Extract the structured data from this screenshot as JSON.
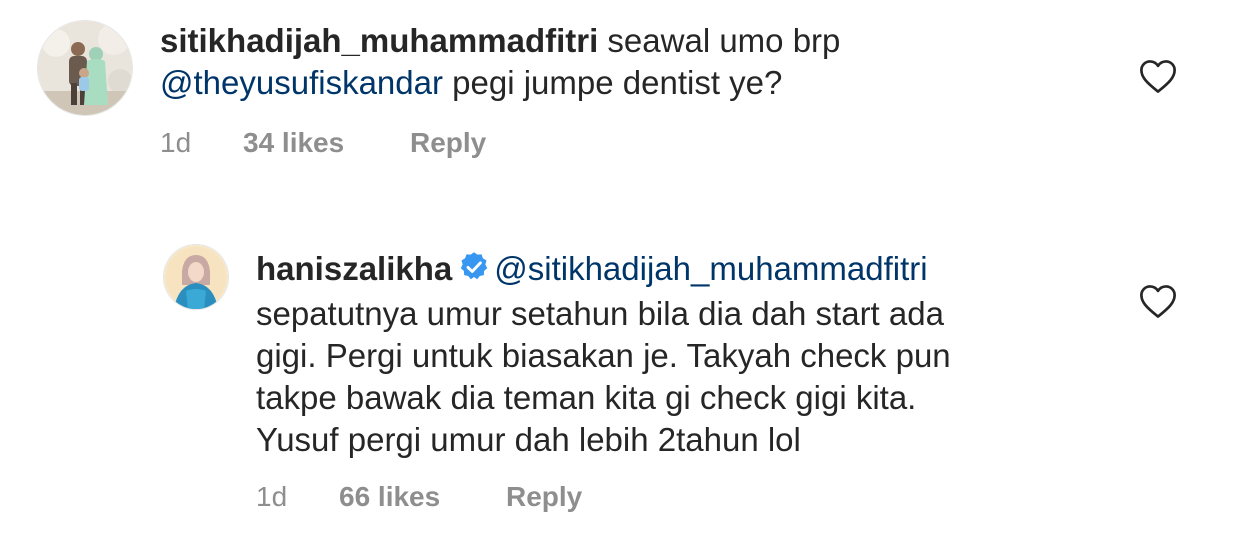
{
  "comments": [
    {
      "username": "sitikhadijah_muhammadfitri",
      "text_before": " seawal umo brp",
      "mention": "@theyusufiskandar",
      "text_after": " pegi jumpe dentist ye?",
      "time": "1d",
      "likes": "34 likes",
      "reply_label": "Reply",
      "verified": false,
      "avatar_icon": "profile-photo"
    },
    {
      "username": "haniszalikha",
      "verified": true,
      "verified_icon": "verified-badge-icon",
      "mention": "@sitikhadijah_muhammadfitri",
      "text_lines": [
        "sepatutnya umur setahun bila dia dah start ada",
        "gigi. Pergi untuk biasakan je. Takyah check pun",
        "takpe bawak dia teman kita gi check gigi kita.",
        "Yusuf pergi umur dah lebih 2tahun lol"
      ],
      "time": "1d",
      "likes": "66 likes",
      "reply_label": "Reply",
      "avatar_icon": "profile-illustration"
    }
  ],
  "icons": {
    "like": "heart-outline-icon",
    "verified_color": "#3897f0"
  },
  "colors": {
    "text": "#262626",
    "meta": "#8e8e8e",
    "mention": "#003569"
  }
}
